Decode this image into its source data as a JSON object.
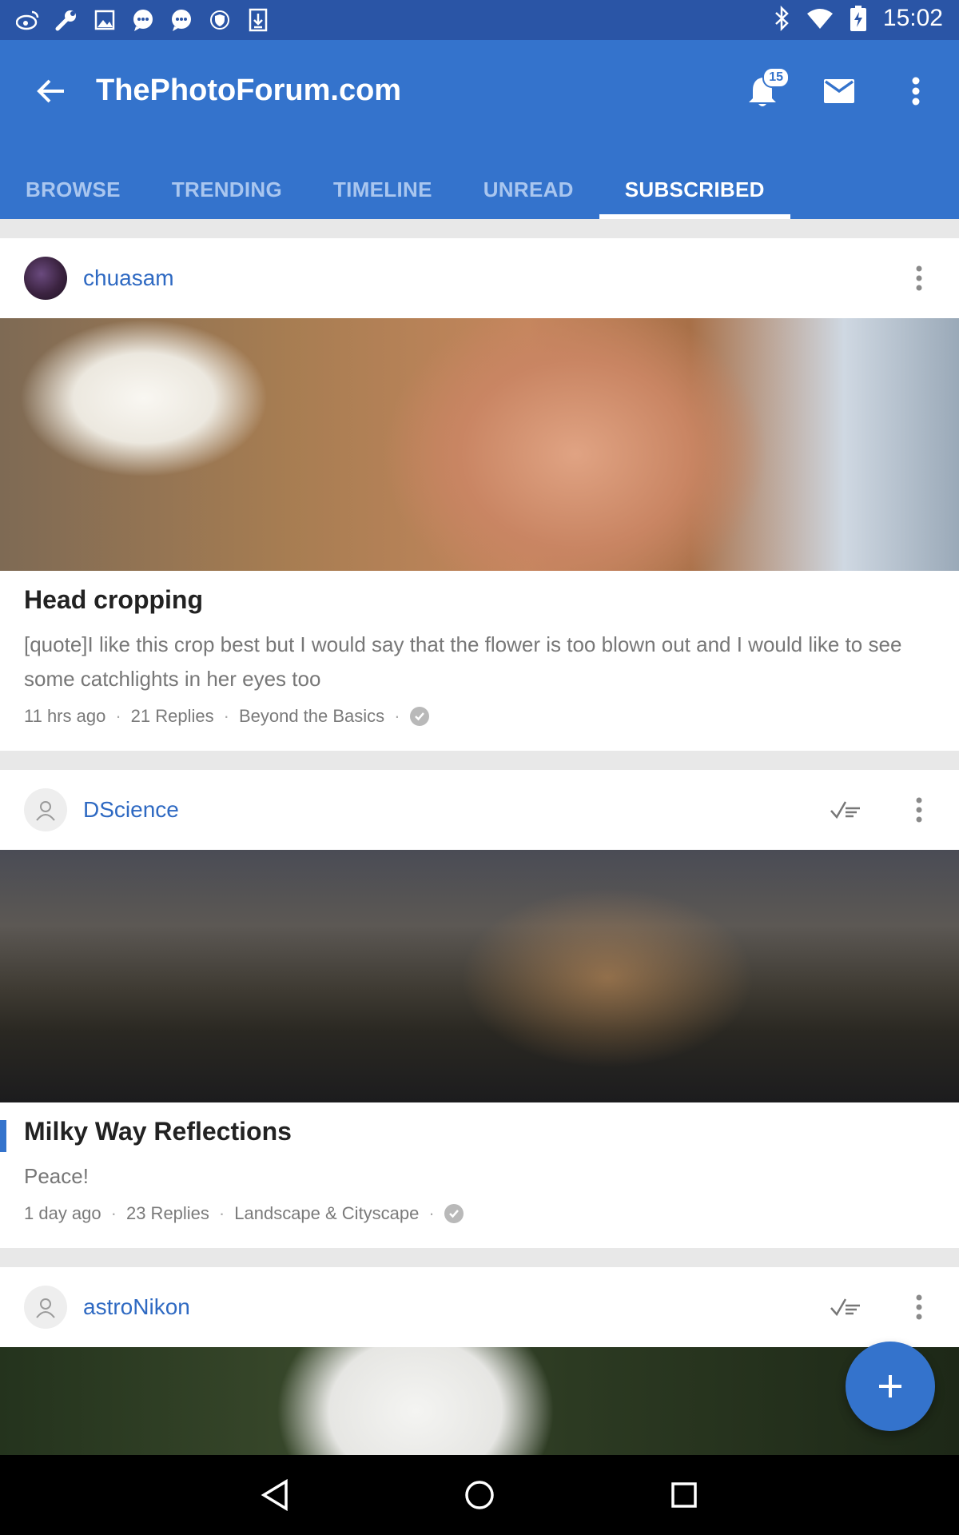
{
  "status_bar": {
    "time": "15:02",
    "left_icons": [
      "weibo-icon",
      "wrench-icon",
      "image-icon",
      "chat-icon",
      "chat-icon",
      "shield-icon",
      "download-icon"
    ],
    "right_icons": [
      "bluetooth-icon",
      "wifi-icon",
      "battery-charging-icon"
    ]
  },
  "app_bar": {
    "title": "ThePhotoForum.com",
    "notification_count": "15",
    "back_icon": "arrow-back-icon",
    "actions": [
      "bell-icon",
      "mail-icon",
      "more-vert-icon"
    ]
  },
  "tabs": [
    {
      "label": "BROWSE",
      "active": false
    },
    {
      "label": "TRENDING",
      "active": false
    },
    {
      "label": "TIMELINE",
      "active": false
    },
    {
      "label": "UNREAD",
      "active": false
    },
    {
      "label": "SUBSCRIBED",
      "active": true
    }
  ],
  "posts": [
    {
      "username": "chuasam",
      "title": "Head cropping",
      "snippet": "[quote]I like this crop best but I would say that the flower is too blown out and I would like to see some catchlights in her eyes too",
      "time": "11 hrs ago",
      "replies": "21 Replies",
      "forum": "Beyond the Basics"
    },
    {
      "username": "DScience",
      "title": "Milky Way Reflections",
      "snippet": "Peace!",
      "time": "1 day ago",
      "replies": "23 Replies",
      "forum": "Landscape & Cityscape"
    },
    {
      "username": "astroNikon"
    }
  ],
  "colors": {
    "status_bar": "#2a55a6",
    "primary": "#3473cc",
    "username": "#2e69c2",
    "background": "#e8e8e8"
  }
}
